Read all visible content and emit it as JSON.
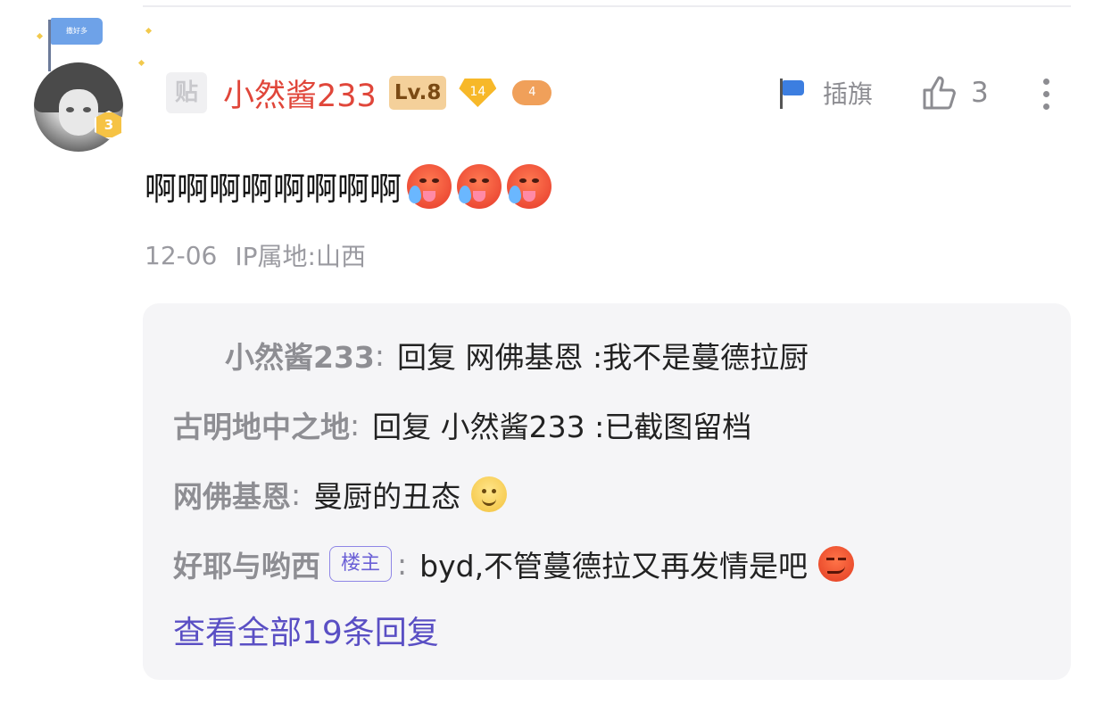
{
  "post": {
    "author": {
      "avatar_flag_text": "撒好多",
      "user_level": "3",
      "platform_badge": "贴",
      "name": "小然酱233",
      "lv_badge": "Lv.8",
      "diamond_badge": "14",
      "game_badge": "4"
    },
    "actions": {
      "flag_label": "插旗",
      "like_count": "3"
    },
    "content": {
      "text": "啊啊啊啊啊啊啊啊",
      "emojis": [
        "hot-face-emoji",
        "hot-face-emoji",
        "hot-face-emoji"
      ]
    },
    "meta": {
      "date": "12-06",
      "ip": "IP属地:山西"
    },
    "replies": [
      {
        "author": "小然酱233",
        "separator": ":",
        "text": "回复 网佛基恩 :我不是蔓德拉厨"
      },
      {
        "author": "古明地中之地",
        "separator": ":",
        "text": "回复 小然酱233 :已截图留档"
      },
      {
        "author": "网佛基恩",
        "separator": ":",
        "text": "曼厨的丑态",
        "emoji": "smile-emoji"
      },
      {
        "author": "好耶与哟西",
        "tag": "楼主",
        "separator": ":",
        "text": "byd,不管蔓德拉又再发情是吧",
        "emoji": "smirk-emoji"
      }
    ],
    "view_all": "查看全部19条回复"
  },
  "colors": {
    "username": "#e0463a",
    "link": "#5a4fc4",
    "muted": "#8e8e93",
    "reply_bg": "#f5f5f7"
  }
}
